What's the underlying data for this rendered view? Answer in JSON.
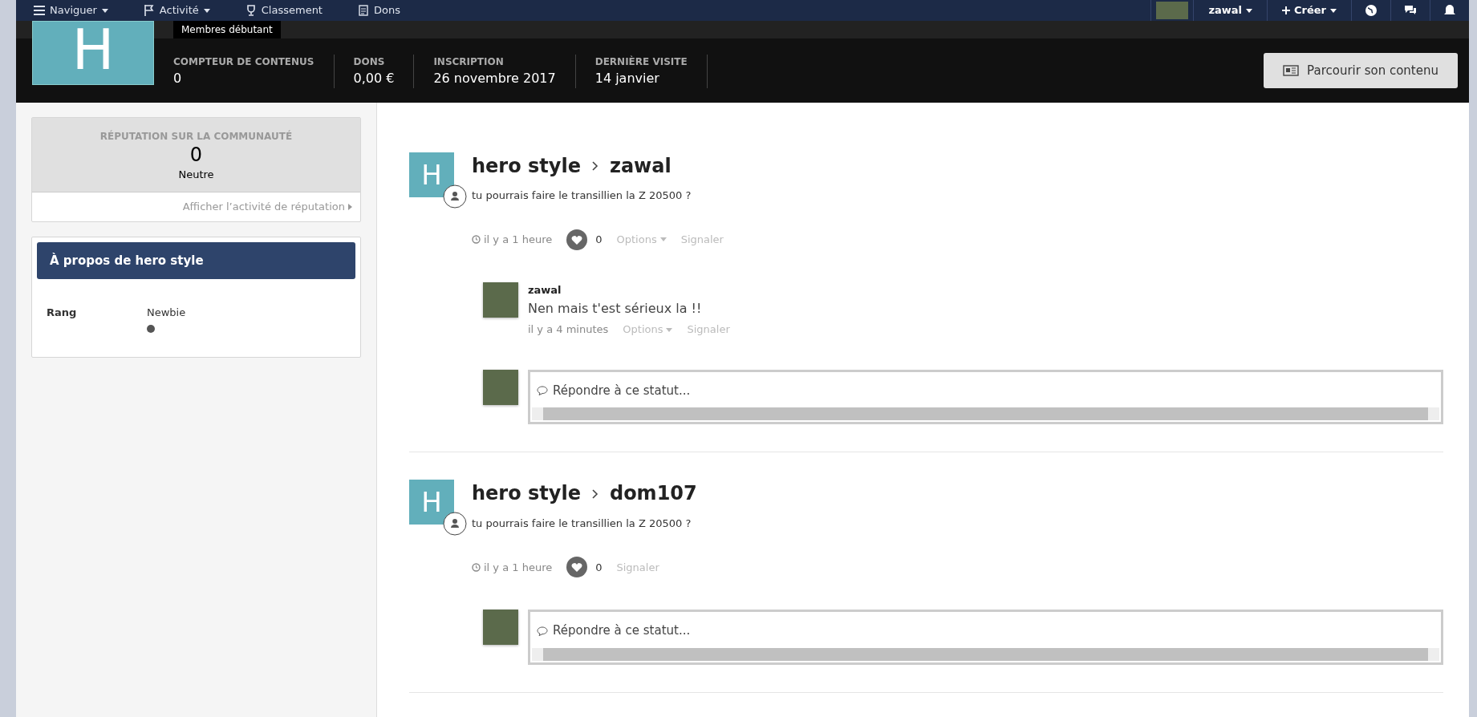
{
  "nav": {
    "items": [
      {
        "label": "Naviguer",
        "dropdown": true
      },
      {
        "label": "Activité",
        "dropdown": true
      },
      {
        "label": "Classement",
        "dropdown": false
      },
      {
        "label": "Dons",
        "dropdown": false
      }
    ],
    "user": "zawal",
    "create": "Créer"
  },
  "profile": {
    "initial": "H",
    "group": "Membres débutant",
    "stats": [
      {
        "label": "COMPTEUR DE CONTENUS",
        "value": "0"
      },
      {
        "label": "DONS",
        "value": "0,00 €"
      },
      {
        "label": "INSCRIPTION",
        "value": "26 novembre 2017"
      },
      {
        "label": "DERNIÈRE VISITE",
        "value": "14 janvier"
      }
    ],
    "browse_button": "Parcourir son contenu"
  },
  "reputation": {
    "title": "RÉPUTATION SUR LA COMMUNAUTÉ",
    "value": "0",
    "standing": "Neutre",
    "link": "Afficher l’activité de réputation"
  },
  "about": {
    "title": "À propos de hero style",
    "fields": [
      {
        "label": "Rang",
        "value": "Newbie"
      }
    ]
  },
  "statuses": [
    {
      "initial": "H",
      "author": "hero style",
      "target": "zawal",
      "text": "tu pourrais faire le transillien la Z 20500 ?",
      "time": "il y a 1 heure",
      "likes": "0",
      "options": "Options",
      "report": "Signaler",
      "replies": [
        {
          "author": "zawal",
          "text": "Nen mais t'est sérieux la !!",
          "time": "il y a 4 minutes",
          "options": "Options",
          "report": "Signaler"
        }
      ],
      "reply_placeholder": "Répondre à ce statut..."
    },
    {
      "initial": "H",
      "author": "hero style",
      "target": "dom107",
      "text": "tu pourrais faire le transillien la Z 20500 ?",
      "time": "il y a 1 heure",
      "likes": "0",
      "report": "Signaler",
      "reply_placeholder": "Répondre à ce statut..."
    }
  ]
}
